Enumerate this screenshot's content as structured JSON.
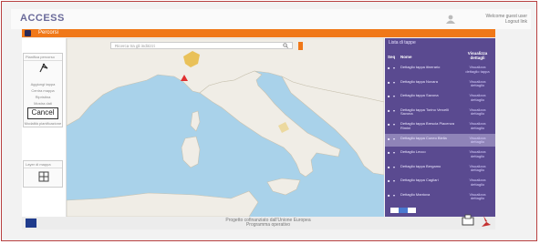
{
  "app": {
    "logo_text": "ACCESS",
    "user": {
      "line1": "Welcome guest user",
      "line2": "Logout link"
    }
  },
  "header": {
    "title": "Percorsi"
  },
  "side_panel": {
    "section1_title": "Pianifica percorso",
    "tools": [
      "Aggiungi tappa",
      "Centra mappa",
      "Ripristina",
      "Mostra dati"
    ],
    "cancel_label": "Cancel",
    "section1_footer": "Modalità pianificazione",
    "section2_title": "Layer di mappa"
  },
  "map": {
    "search_placeholder": "Ricerca tra gli indirizzi"
  },
  "right_panel": {
    "title": "Lista di tappe",
    "headers": {
      "seq": "Seq",
      "name": "Nome",
      "link": "Visualizza dettagli"
    },
    "rows": [
      {
        "name": "Dettaglio tappa itinerario",
        "link": "Visualizza dettaglio tappa",
        "selected": false
      },
      {
        "name": "Dettaglio tappa Novara",
        "link": "Visualizza dettaglio",
        "selected": false
      },
      {
        "name": "Dettaglio tappa Savona",
        "link": "Visualizza dettaglio",
        "selected": false
      },
      {
        "name": "Dettaglio tappa Torino Vercelli Savona",
        "link": "Visualizza dettaglio",
        "selected": false
      },
      {
        "name": "Dettaglio tappa Brescia Piacenza Rimini",
        "link": "Visualizza dettaglio",
        "selected": false
      },
      {
        "name": "Dettaglio tappa Cuneo Biella",
        "link": "Visualizza dettaglio",
        "selected": true
      },
      {
        "name": "Dettaglio Lecco",
        "link": "Visualizza dettaglio",
        "selected": false
      },
      {
        "name": "Dettaglio tappa Bergamo",
        "link": "Visualizza dettaglio",
        "selected": false
      },
      {
        "name": "Dettaglio tappa Cagliari",
        "link": "Visualizza dettaglio",
        "selected": false
      },
      {
        "name": "Dettaglio Mantova",
        "link": "Visualizza dettaglio",
        "selected": false
      }
    ]
  },
  "footer": {
    "line1": "Progetto cofinanziato dall'Unione Europea",
    "line2": "Programma operativo"
  },
  "colors": {
    "accent_orange": "#f07818",
    "panel_purple": "#5a4a90",
    "selected_row": "#8f84b8",
    "sea": "#a9d2ea",
    "land": "#f0ede6"
  }
}
